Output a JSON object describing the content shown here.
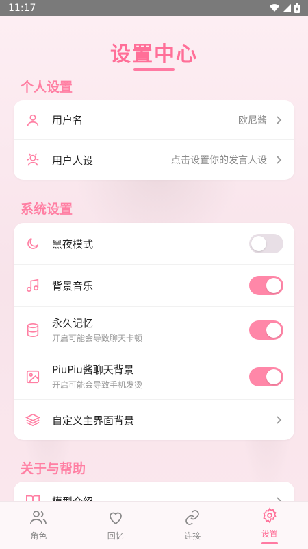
{
  "status_bar": {
    "time": "11:17"
  },
  "header": {
    "title": "设置中心"
  },
  "sections": {
    "personal": {
      "title": "个人设置",
      "items": [
        {
          "label": "用户名",
          "value": "欧尼酱",
          "icon": "user-icon"
        },
        {
          "label": "用户人设",
          "value": "点击设置你的发言人设",
          "icon": "persona-icon"
        }
      ]
    },
    "system": {
      "title": "系统设置",
      "items": [
        {
          "label": "黑夜模式",
          "icon": "moon-icon",
          "toggle": false
        },
        {
          "label": "背景音乐",
          "icon": "music-icon",
          "toggle": true
        },
        {
          "label": "永久记忆",
          "sub": "开启可能会导致聊天卡顿",
          "icon": "database-icon",
          "toggle": true
        },
        {
          "label": "PiuPiu酱聊天背景",
          "sub": "开启可能会导致手机发烫",
          "icon": "image-icon",
          "toggle": true
        },
        {
          "label": "自定义主界面背景",
          "icon": "layers-icon"
        }
      ]
    },
    "about": {
      "title": "关于与帮助",
      "items": [
        {
          "label": "模型介绍",
          "icon": "book-icon"
        }
      ]
    }
  },
  "bottom_nav": {
    "items": [
      {
        "label": "角色",
        "icon": "users-icon",
        "active": false
      },
      {
        "label": "回忆",
        "icon": "heart-icon",
        "active": false
      },
      {
        "label": "连接",
        "icon": "link-icon",
        "active": false
      },
      {
        "label": "设置",
        "icon": "gear-icon",
        "active": true
      }
    ]
  },
  "colors": {
    "accent": "#ff6f98",
    "toggle_on": "#ff87a8",
    "toggle_off": "#e8dfe6",
    "background": "#fbe9ef"
  }
}
